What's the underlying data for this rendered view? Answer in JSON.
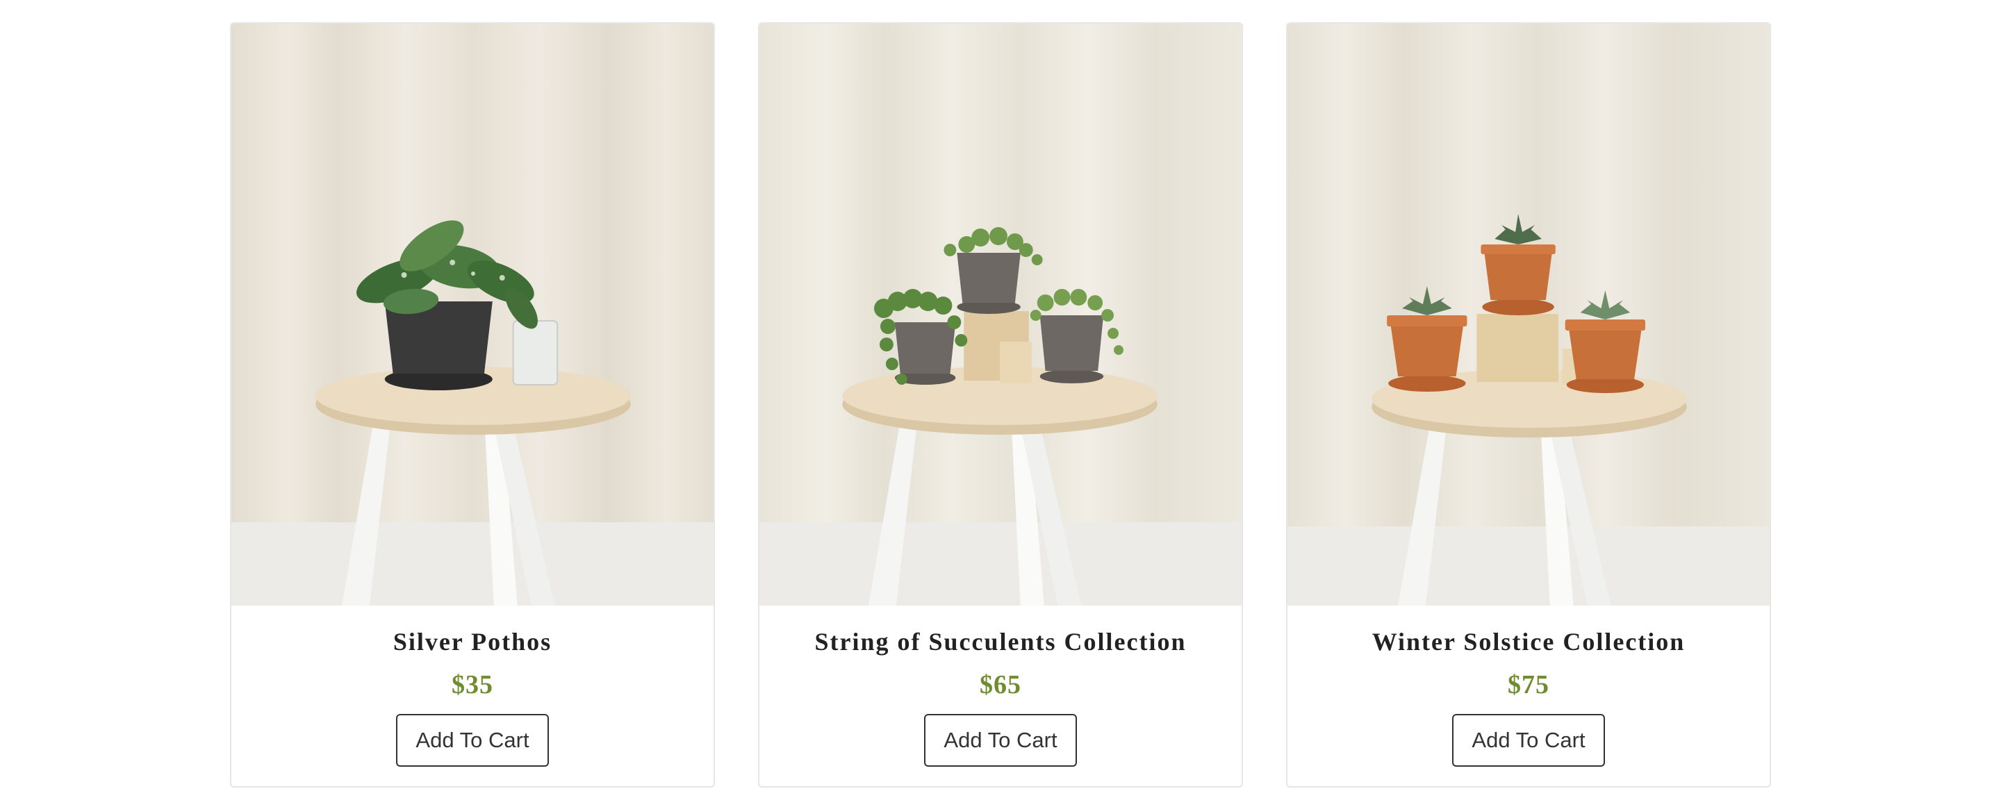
{
  "products": [
    {
      "name": "Silver Pothos",
      "price": "$35",
      "button_label": "Add To Cart",
      "image": "silver-pothos-on-stool"
    },
    {
      "name": "String of Succulents Collection",
      "price": "$65",
      "button_label": "Add To Cart",
      "image": "succulent-trio-on-stool"
    },
    {
      "name": "Winter Solstice Collection",
      "price": "$75",
      "button_label": "Add To Cart",
      "image": "terracotta-succulents-on-stool"
    }
  ],
  "colors": {
    "price": "#6f8c2e",
    "title": "#222222",
    "border": "#e6e6e6"
  }
}
